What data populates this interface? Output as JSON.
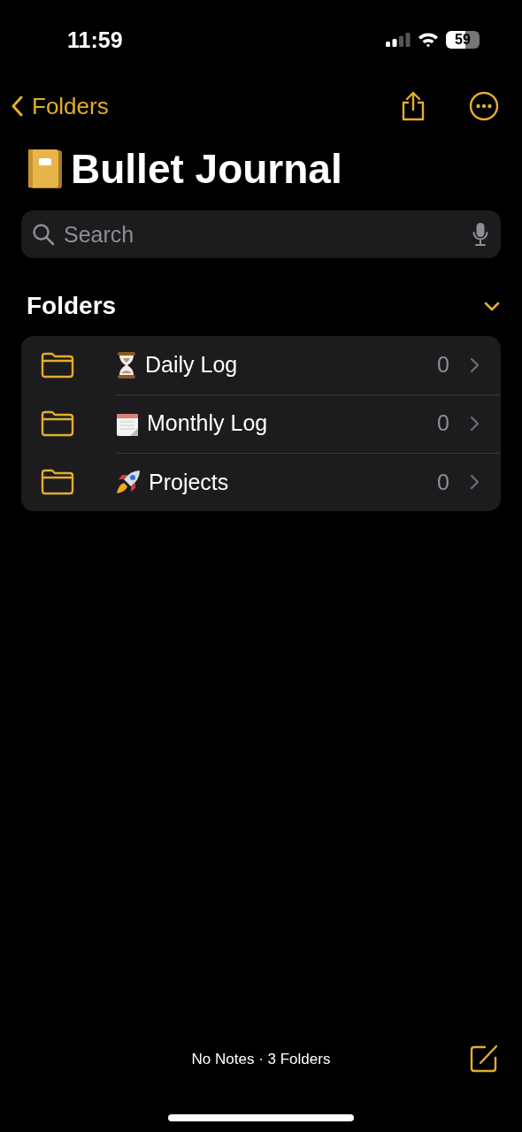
{
  "status_bar": {
    "time": "11:59",
    "battery": "59"
  },
  "nav": {
    "back_label": "Folders"
  },
  "title": "Bullet Journal",
  "search": {
    "placeholder": "Search"
  },
  "section": {
    "title": "Folders",
    "expanded": true
  },
  "folders": [
    {
      "name": "Daily Log",
      "count": "0"
    },
    {
      "name": "Monthly Log",
      "count": "0"
    },
    {
      "name": "Projects",
      "count": "0"
    }
  ],
  "footer": {
    "summary": "No Notes · 3 Folders"
  }
}
